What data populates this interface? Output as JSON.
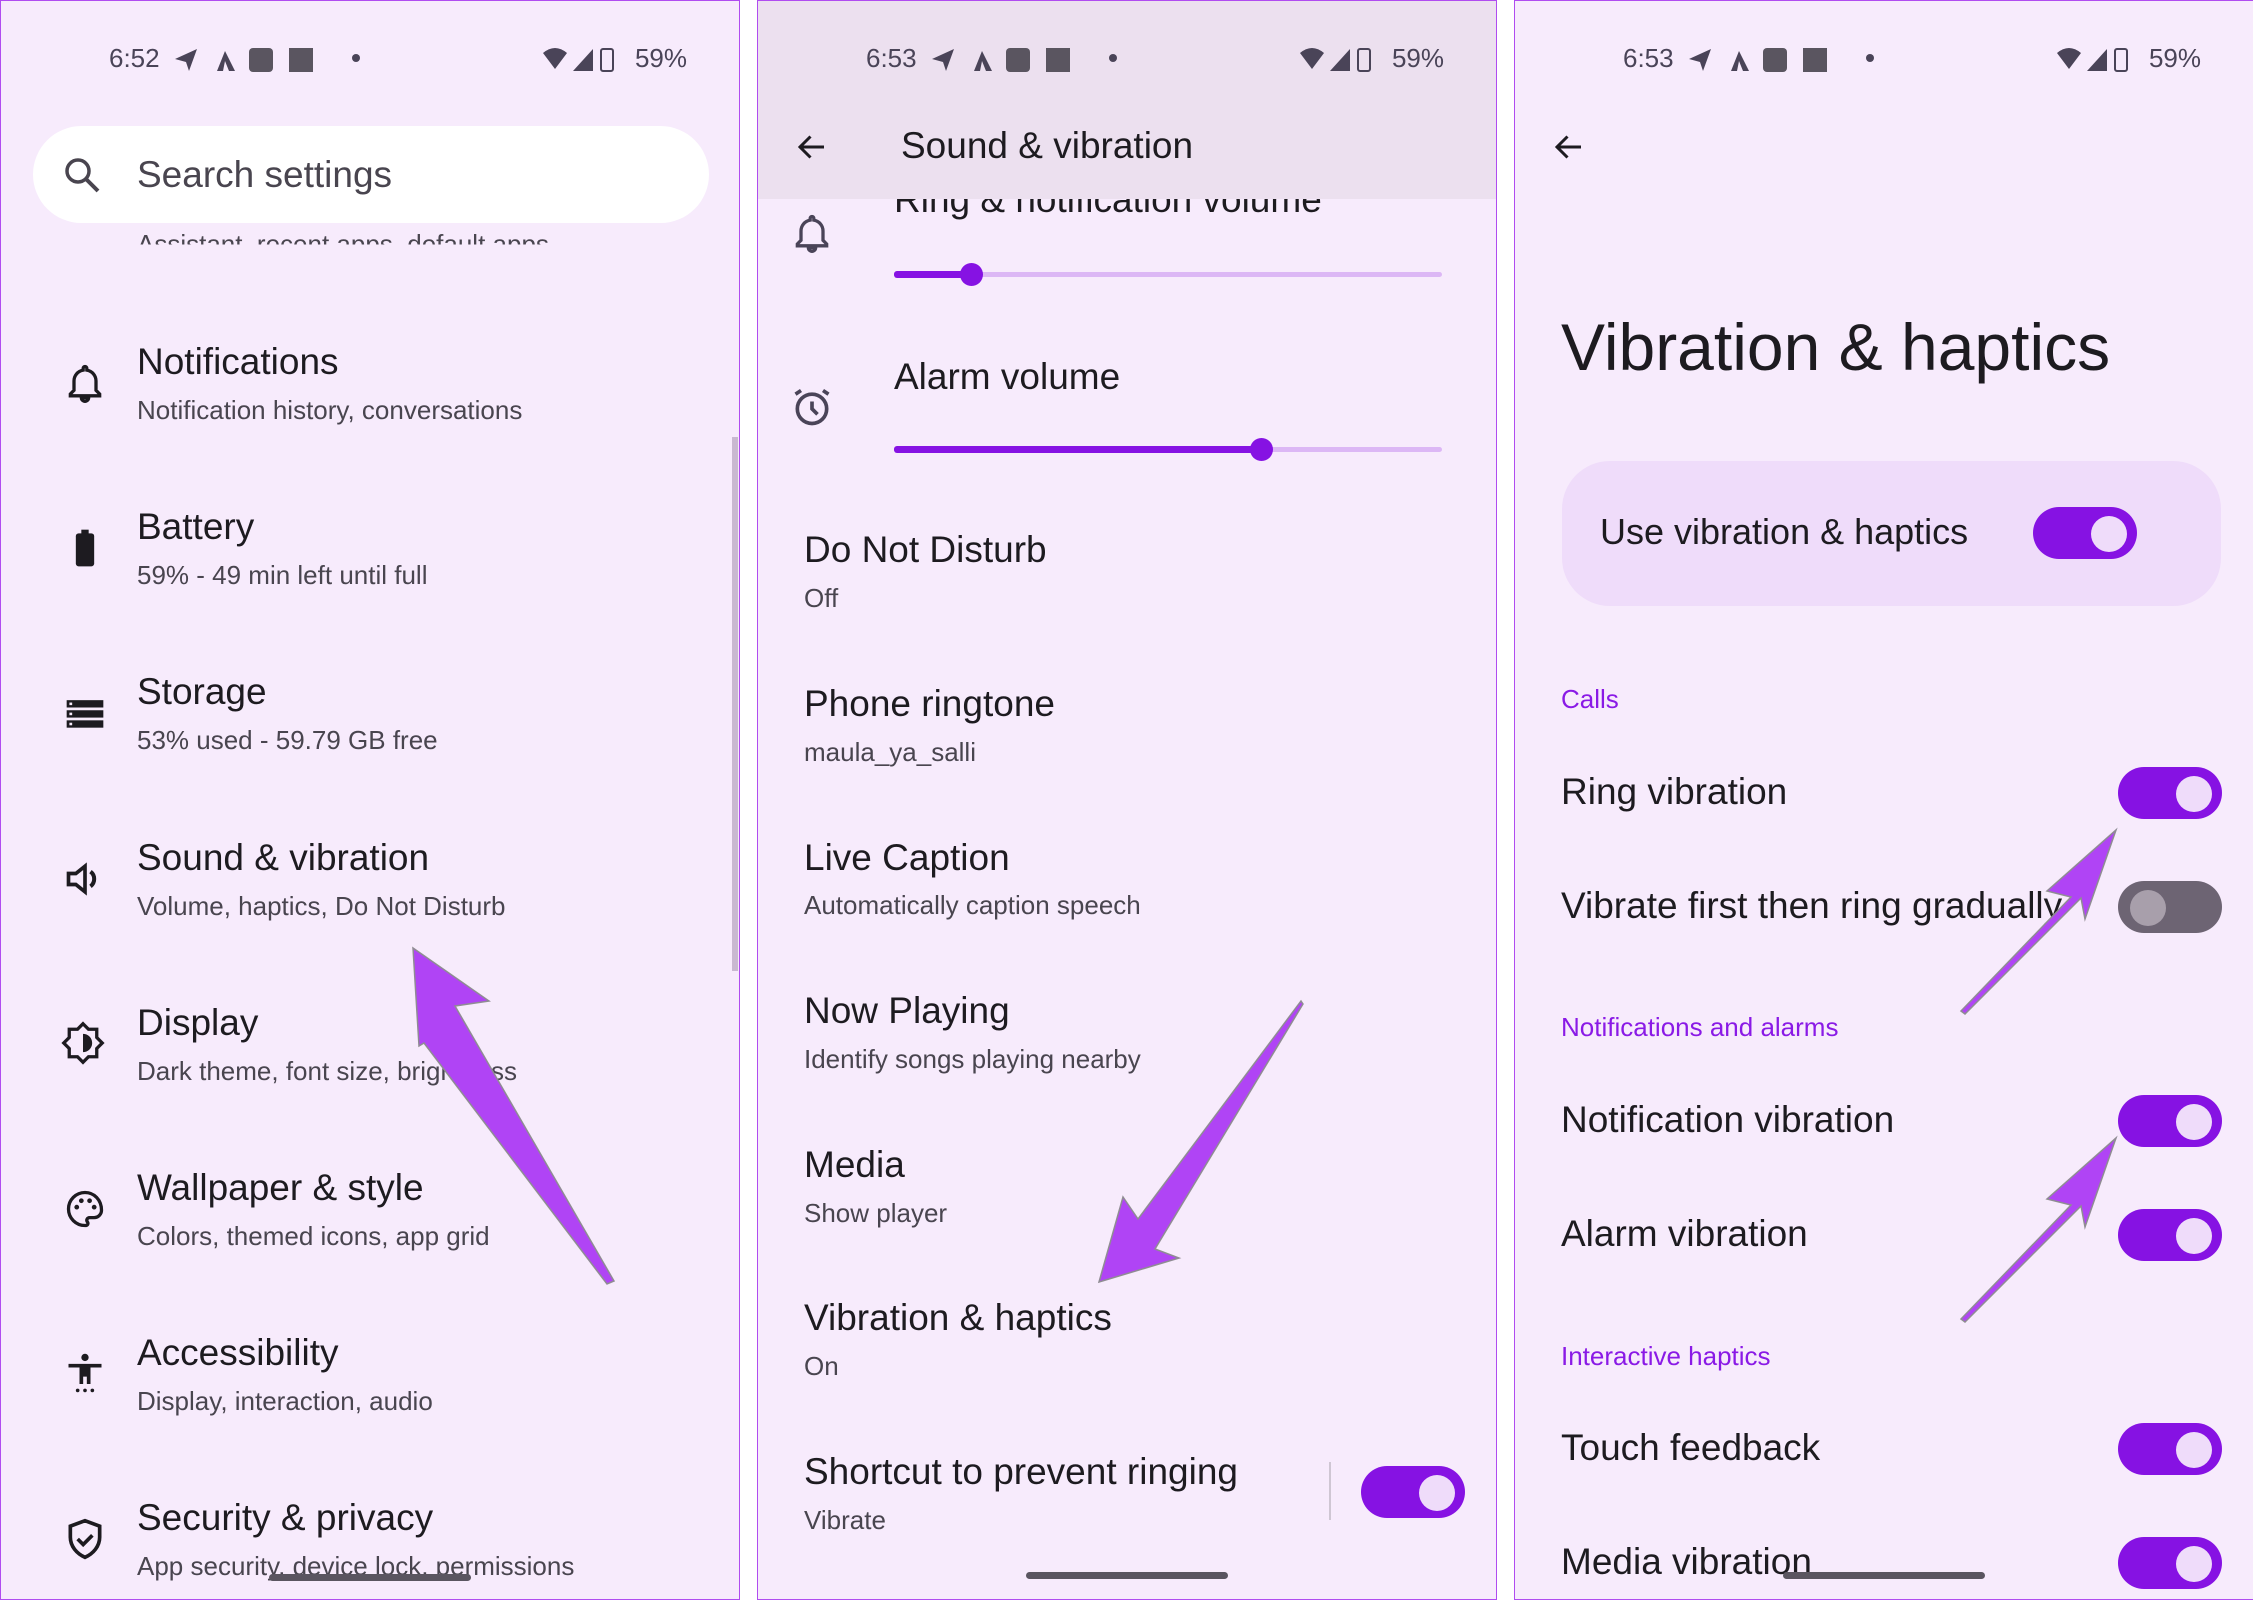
{
  "panels": {
    "settings": {
      "status": {
        "time": "6:52",
        "battery_pct": "59%"
      },
      "search": {
        "placeholder": "Search settings"
      },
      "partial_item_subtitle": "Assistant, recent apps, default apps",
      "items": [
        {
          "title": "Notifications",
          "subtitle": "Notification history, conversations",
          "icon": "bell-icon"
        },
        {
          "title": "Battery",
          "subtitle": "59% - 49 min left until full",
          "icon": "battery-icon"
        },
        {
          "title": "Storage",
          "subtitle": "53% used - 59.79 GB free",
          "icon": "storage-icon"
        },
        {
          "title": "Sound & vibration",
          "subtitle": "Volume, haptics, Do Not Disturb",
          "icon": "volume-icon"
        },
        {
          "title": "Display",
          "subtitle": "Dark theme, font size, brightness",
          "icon": "brightness-icon"
        },
        {
          "title": "Wallpaper & style",
          "subtitle": "Colors, themed icons, app grid",
          "icon": "palette-icon"
        },
        {
          "title": "Accessibility",
          "subtitle": "Display, interaction, audio",
          "icon": "accessibility-icon"
        },
        {
          "title": "Security & privacy",
          "subtitle": "App security, device lock, permissions",
          "icon": "shield-check-icon"
        }
      ]
    },
    "sound": {
      "status": {
        "time": "6:53",
        "battery_pct": "59%"
      },
      "header": {
        "title": "Sound & vibration"
      },
      "sliders": [
        {
          "label": "Ring & notification volume",
          "value_fraction": 0.14,
          "icon": "bell-icon"
        },
        {
          "label": "Alarm volume",
          "value_fraction": 0.67,
          "icon": "alarm-clock-icon"
        }
      ],
      "items": [
        {
          "title": "Do Not Disturb",
          "subtitle": "Off"
        },
        {
          "title": "Phone ringtone",
          "subtitle": "maula_ya_salli"
        },
        {
          "title": "Live Caption",
          "subtitle": "Automatically caption speech"
        },
        {
          "title": "Now Playing",
          "subtitle": "Identify songs playing nearby"
        },
        {
          "title": "Media",
          "subtitle": "Show player"
        },
        {
          "title": "Vibration & haptics",
          "subtitle": "On"
        },
        {
          "title": "Shortcut to prevent ringing",
          "subtitle": "Vibrate",
          "toggle_on": true
        }
      ]
    },
    "vibration": {
      "status": {
        "time": "6:53",
        "battery_pct": "59%"
      },
      "page_title": "Vibration & haptics",
      "main_toggle": {
        "label": "Use vibration & haptics",
        "on": true
      },
      "sections": [
        {
          "header": "Calls",
          "items": [
            {
              "label": "Ring vibration",
              "on": true
            },
            {
              "label": "Vibrate first then ring gradually",
              "on": false
            }
          ]
        },
        {
          "header": "Notifications and alarms",
          "items": [
            {
              "label": "Notification vibration",
              "on": true
            },
            {
              "label": "Alarm vibration",
              "on": true
            }
          ]
        },
        {
          "header": "Interactive haptics",
          "items": [
            {
              "label": "Touch feedback",
              "on": true
            },
            {
              "label": "Media vibration",
              "on": true
            }
          ]
        }
      ]
    }
  },
  "colors": {
    "accent": "#8612e3",
    "background": "#f7ebfc",
    "annotation_arrow": "#b044f5",
    "section_header": "#8a1ae6"
  }
}
